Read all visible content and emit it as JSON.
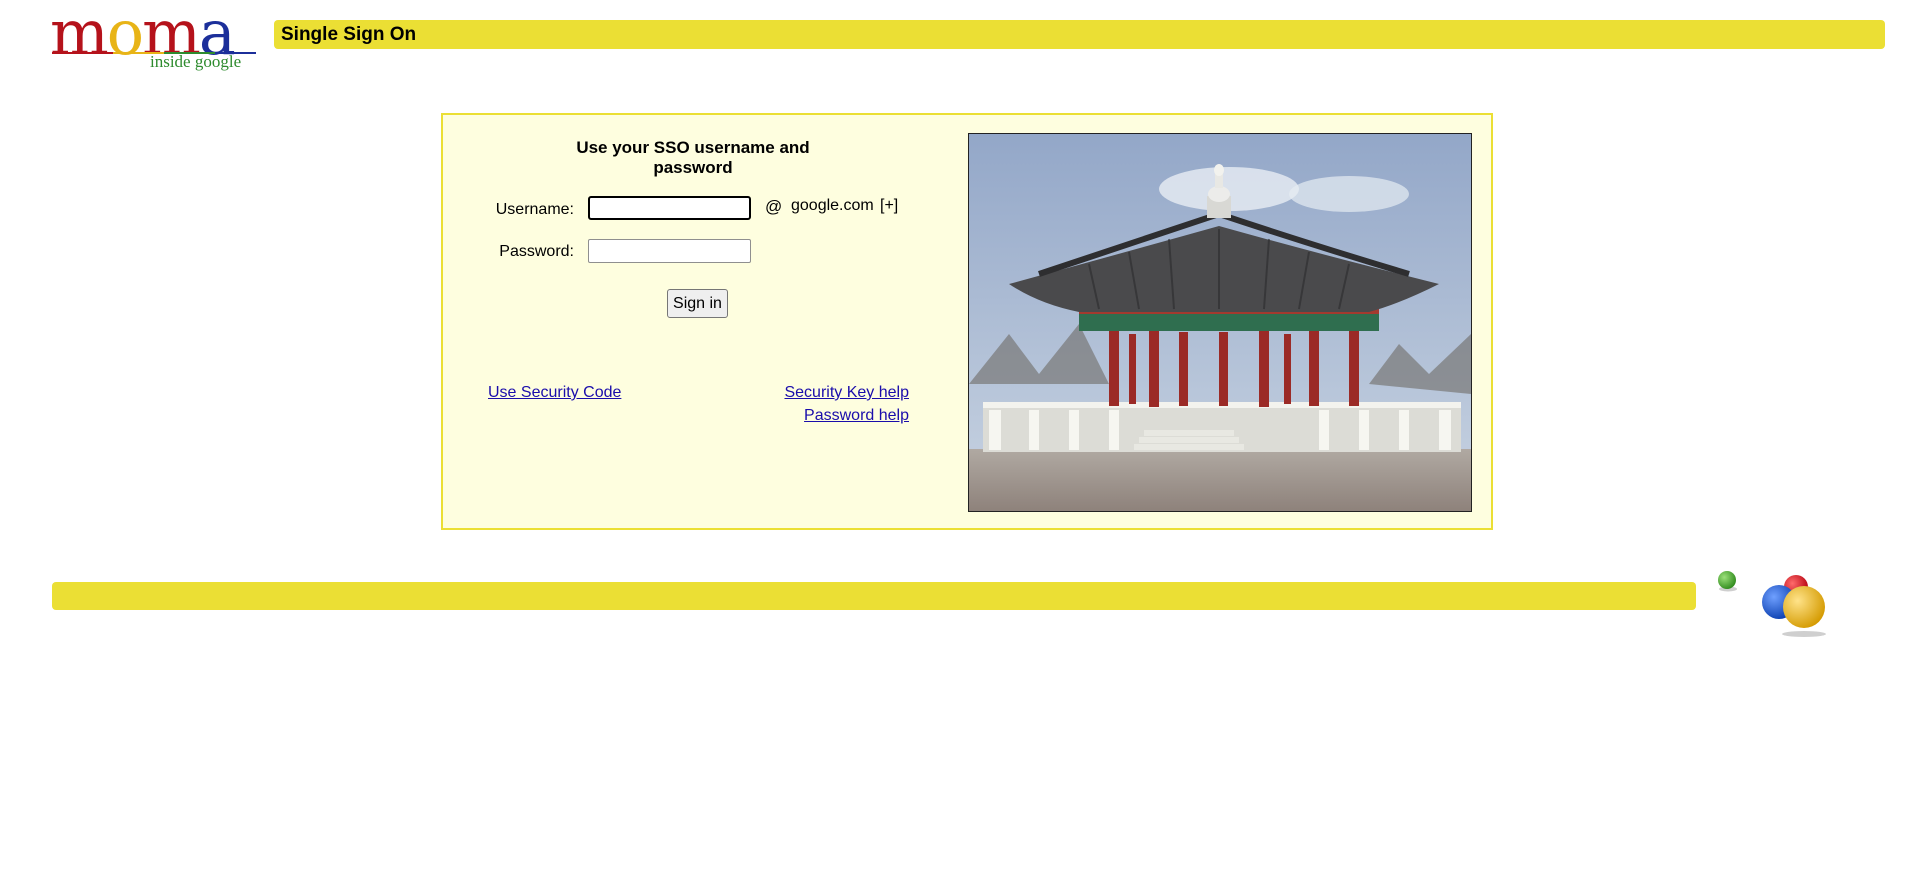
{
  "header": {
    "logo_text": "moma",
    "logo_subtitle": "inside google",
    "title": "Single Sign On"
  },
  "login": {
    "heading": "Use your SSO username and password",
    "username_label": "Username:",
    "username_value": "",
    "at_sign": "@",
    "domain": "google.com",
    "domain_toggle": "[+]",
    "password_label": "Password:",
    "password_value": "",
    "signin_label": "Sign in",
    "security_code_link": "Use Security Code",
    "security_key_link": "Security Key help",
    "password_help_link": "Password help"
  },
  "colors": {
    "accent_yellow": "#ebdf34",
    "panel_background": "#fefedf",
    "link_blue": "#1a0dab"
  },
  "icons": {
    "footer_decoration": "colored-balls-icon",
    "photo": "pavilion-photo"
  }
}
